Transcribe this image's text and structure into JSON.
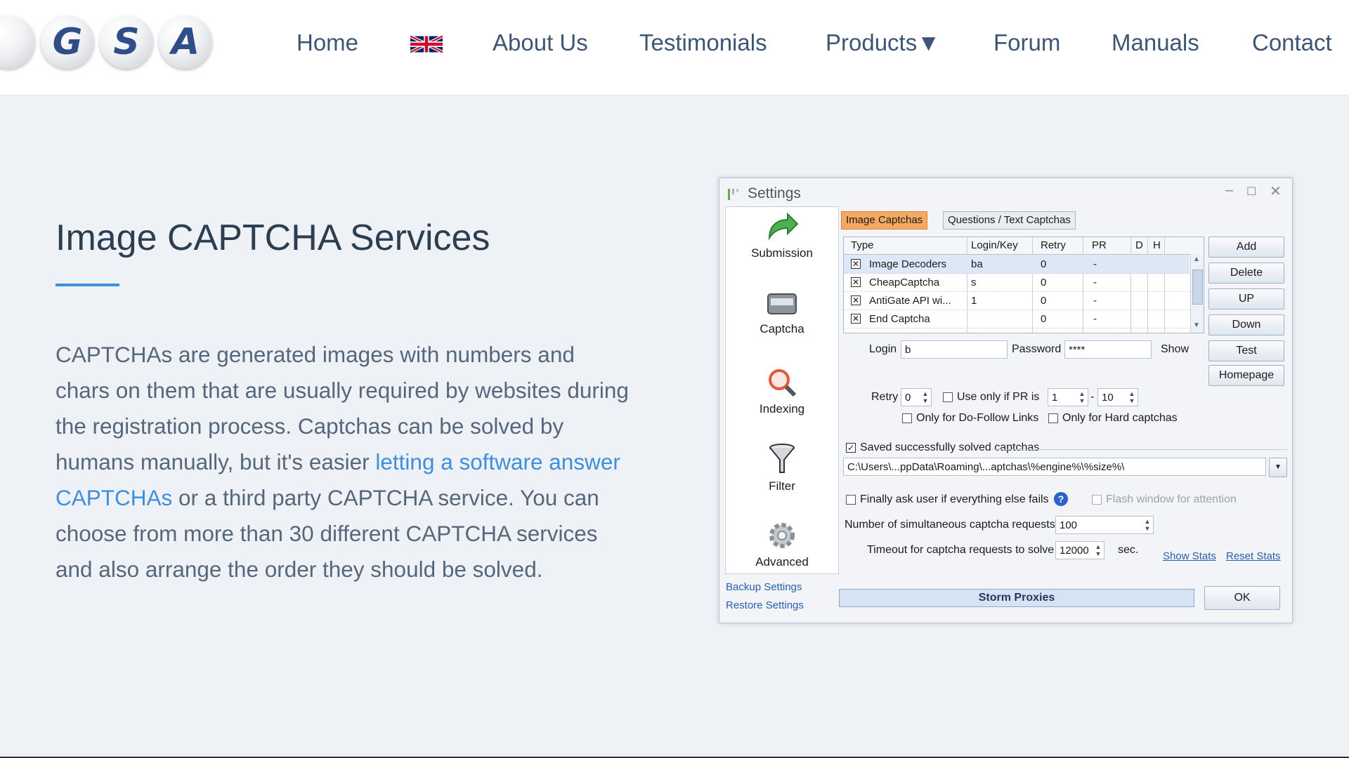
{
  "logo": {
    "letters": [
      "G",
      "S",
      "A"
    ]
  },
  "nav": {
    "home": "Home",
    "language_icon": "uk-flag-icon",
    "about": "About Us",
    "testimonials": "Testimonials",
    "products": "Products▼",
    "forum": "Forum",
    "manuals": "Manuals",
    "contact": "Contact"
  },
  "hero": {
    "title": "Image CAPTCHA Services",
    "text_before": "CAPTCHAs are generated images with numbers and chars on them that are usually required by websites during the registration process. Captchas can be solved by humans manually, but it's easier ",
    "link_text": "letting a software answer CAPTCHAs",
    "text_after": " or a third party CAPTCHA service. You can choose from more than 30 different CAPTCHA services and also arrange the order they should be solved."
  },
  "settings_window": {
    "title": "Settings",
    "sidebar": {
      "items": [
        "Submission",
        "Captcha",
        "Indexing",
        "Filter",
        "Advanced"
      ],
      "backup": "Backup Settings",
      "restore": "Restore Settings"
    },
    "tabs": [
      "Image Captchas",
      "Questions / Text Captchas"
    ],
    "table": {
      "columns": [
        "Type",
        "Login/Key",
        "Retry",
        "PR",
        "D",
        "H"
      ],
      "rows": [
        {
          "type": "Image Decoders",
          "login": "ba",
          "retry": "0",
          "pr": "-"
        },
        {
          "type": "CheapCaptcha",
          "login": "s",
          "retry": "0",
          "pr": "-"
        },
        {
          "type": "AntiGate API wi...",
          "login": "1",
          "retry": "0",
          "pr": "-"
        },
        {
          "type": "End Captcha",
          "login": "",
          "retry": "0",
          "pr": "-"
        }
      ]
    },
    "buttons": {
      "add": "Add",
      "delete": "Delete",
      "up": "UP",
      "down": "Down",
      "test": "Test",
      "homepage": "Homepage",
      "ok": "OK"
    },
    "login_label": "Login",
    "login_value": "b",
    "password_label": "Password",
    "password_value": "****",
    "show_label": "Show",
    "retry_label": "Retry",
    "retry_value": "0",
    "use_only_if_pr": "Use only if PR is",
    "pr_from": "1",
    "pr_dash": "-",
    "pr_to": "10",
    "only_dofollow": "Only for Do-Follow Links",
    "only_hard": "Only for Hard captchas",
    "saved_solved": "Saved successfully solved captchas",
    "saved_path": "C:\\Users\\...ppData\\Roaming\\...aptchas\\%engine%\\%size%\\",
    "finally_ask": "Finally ask user if everything else fails",
    "flash_window": "Flash window for attention",
    "simultaneous_label": "Number of simultaneous captcha requests",
    "simultaneous_value": "100",
    "timeout_label": "Timeout for captcha requests to solve",
    "timeout_value": "12000",
    "timeout_unit": "sec.",
    "show_stats": "Show Stats",
    "reset_stats": "Reset Stats",
    "storm_proxies": "Storm Proxies"
  },
  "colors": {
    "accent": "#3d8fdc",
    "nav_text": "#3e5573",
    "active_tab": "#f4a860"
  }
}
